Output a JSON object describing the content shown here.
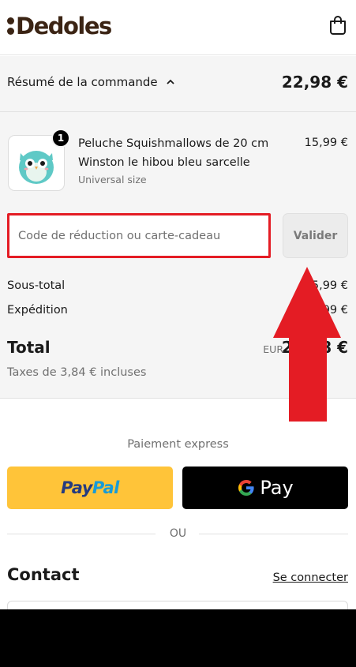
{
  "brand": {
    "name": "Dedoles"
  },
  "header": {
    "cart_icon": "shopping-bag-icon"
  },
  "summary": {
    "toggle_label": "Résumé de la commande",
    "total": "22,98 €"
  },
  "item": {
    "quantity": "1",
    "name": "Peluche Squishmallows de 20 cm Winston le hibou bleu sarcelle",
    "variant": "Universal size",
    "price": "15,99 €"
  },
  "discount": {
    "placeholder": "Code de réduction ou carte-cadeau",
    "apply_label": "Valider"
  },
  "totals": {
    "subtotal_label": "Sous-total",
    "subtotal_value": "15,99 €",
    "shipping_label": "Expédition",
    "shipping_value": "6,99 €",
    "total_label": "Total",
    "currency": "EUR",
    "total_value": "22,98 €",
    "taxes": "Taxes de 3,84 € incluses"
  },
  "express": {
    "title": "Paiement express",
    "paypal_pay": "Pay",
    "paypal_pal": "Pal",
    "gpay_label": "Pay",
    "or_label": "OU"
  },
  "contact": {
    "title": "Contact",
    "login_link": "Se connecter"
  },
  "colors": {
    "brand": "#3b2414",
    "highlight_red": "#e41c24",
    "paypal_yellow": "#ffc439"
  }
}
